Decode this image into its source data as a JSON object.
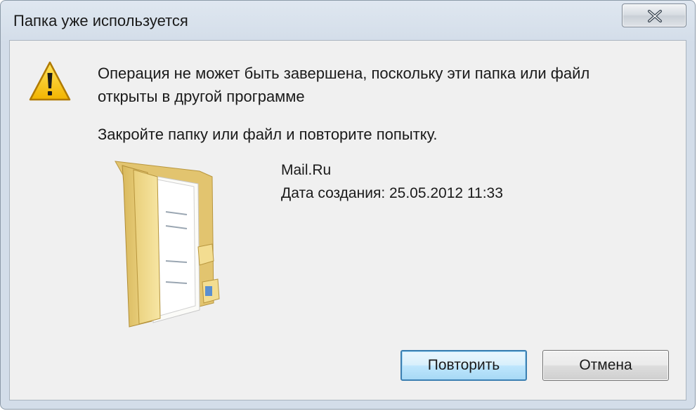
{
  "window": {
    "title": "Папка уже используется"
  },
  "dialog": {
    "message_line1": "Операция не может быть завершена, поскольку эти папка или файл",
    "message_line2": "открыты в другой программе",
    "instruction": "Закройте папку или файл и повторите попытку."
  },
  "file": {
    "name": "Mail.Ru",
    "created": "Дата создания: 25.05.2012 11:33"
  },
  "buttons": {
    "retry_label": "Повторить",
    "cancel_label": "Отмена"
  },
  "icons": {
    "close": "close-icon",
    "warning": "warning-icon",
    "folder": "folder-icon"
  },
  "colors": {
    "default_button_border": "#3c7fb1",
    "dialog_background": "#f0f0f0",
    "warning_yellow": "#f6c700"
  }
}
